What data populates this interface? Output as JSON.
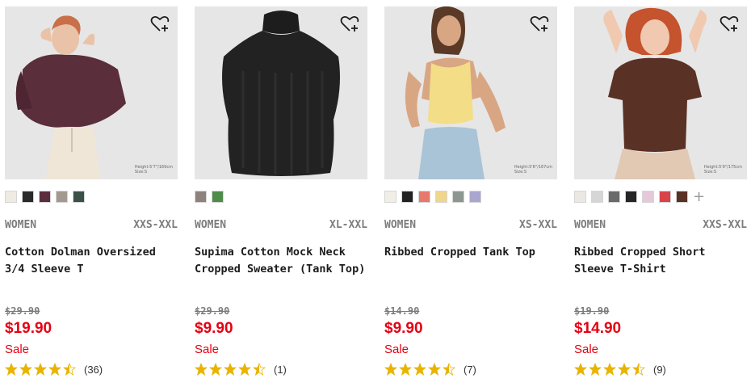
{
  "colors": {
    "sale": "#e60012",
    "star": "#e8b400",
    "muted": "#7d7d7d"
  },
  "icons": {
    "wishlist": "heart-plus-icon",
    "star": "star-icon",
    "more_colors": "plus-icon"
  },
  "products": [
    {
      "category": "WOMEN",
      "sizes": "XXS-XXL",
      "name": "Cotton Dolman Oversized 3/4 Sleeve T",
      "original_price": "$29.90",
      "price": "$19.90",
      "flag": "Sale",
      "rating": 4.5,
      "review_count": "(36)",
      "model_info": [
        "Height:5'7\"/169cm",
        "Size:S"
      ],
      "swatches": [
        "#efebe2",
        "#2a2a2a",
        "#5b2e3c",
        "#a39990",
        "#3b5046"
      ]
    },
    {
      "category": "WOMEN",
      "sizes": "XL-XXL",
      "name": "Supima Cotton Mock Neck Cropped Sweater (Tank Top)",
      "original_price": "$29.90",
      "price": "$9.90",
      "flag": "Sale",
      "rating": 4.5,
      "review_count": "(1)",
      "model_info": [],
      "swatches": [
        "#8e827d",
        "#4f8c4a"
      ]
    },
    {
      "category": "WOMEN",
      "sizes": "XS-XXL",
      "name": "Ribbed Cropped Tank Top",
      "original_price": "$14.90",
      "price": "$9.90",
      "flag": "Sale",
      "rating": 4.5,
      "review_count": "(7)",
      "model_info": [
        "Height:5'6\"/167cm",
        "Size:S"
      ],
      "swatches": [
        "#f1eee6",
        "#222222",
        "#e8786b",
        "#f0d58c",
        "#8e9691",
        "#a9a6cf"
      ]
    },
    {
      "category": "WOMEN",
      "sizes": "XXS-XXL",
      "name": "Ribbed Cropped Short Sleeve T-Shirt",
      "original_price": "$19.90",
      "price": "$14.90",
      "flag": "Sale",
      "rating": 4.5,
      "review_count": "(9)",
      "model_info": [
        "Height:5'9\"/175cm",
        "Size:S"
      ],
      "swatches": [
        "#ebe8e3",
        "#d6d6d6",
        "#6a6a6a",
        "#262626",
        "#e6c9d8",
        "#d9434a",
        "#5a3125"
      ],
      "more_swatches": "+"
    }
  ]
}
